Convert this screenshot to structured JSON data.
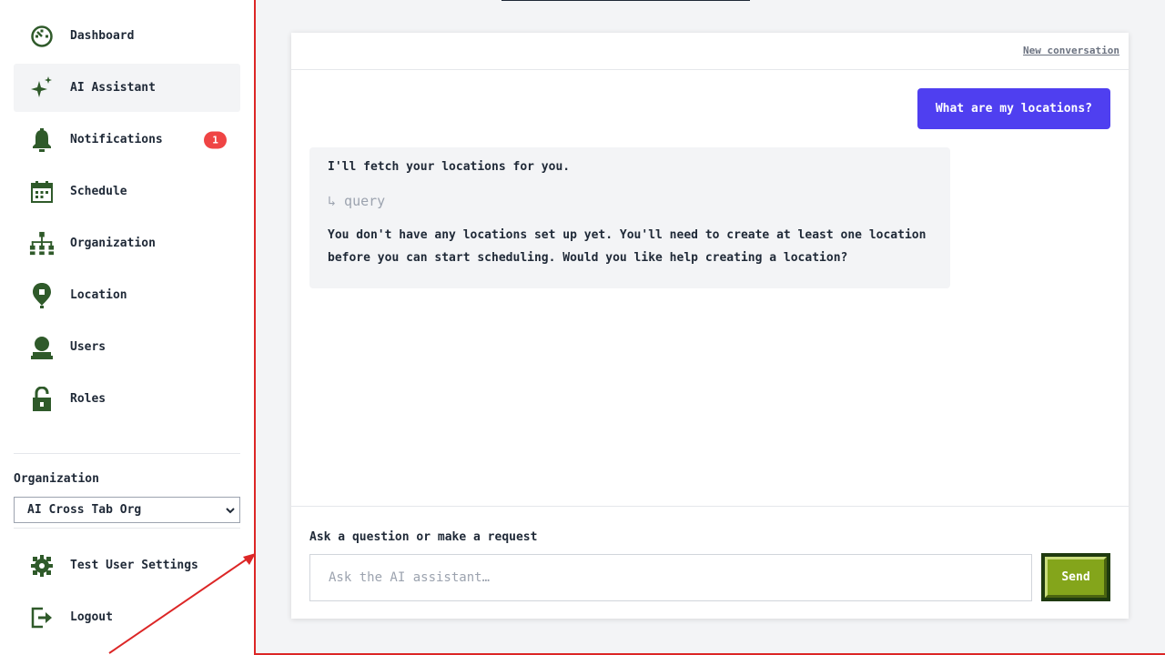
{
  "sidebar": {
    "items": [
      {
        "label": "Dashboard",
        "icon": "dashboard-icon"
      },
      {
        "label": "AI Assistant",
        "icon": "sparkle-icon",
        "active": true
      },
      {
        "label": "Notifications",
        "icon": "bell-icon",
        "badge": "1"
      },
      {
        "label": "Schedule",
        "icon": "calendar-icon"
      },
      {
        "label": "Organization",
        "icon": "org-chart-icon"
      },
      {
        "label": "Location",
        "icon": "location-pin-icon"
      },
      {
        "label": "Users",
        "icon": "user-icon"
      },
      {
        "label": "Roles",
        "icon": "lock-icon"
      }
    ],
    "organization_label": "Organization",
    "organization_value": "AI Cross Tab Org",
    "bottom_items": [
      {
        "label": "Test User Settings",
        "icon": "gear-icon"
      },
      {
        "label": "Logout",
        "icon": "logout-icon"
      }
    ]
  },
  "chat": {
    "new_conversation": "New conversation",
    "user_message": "What are my locations?",
    "assistant": {
      "intro": "I'll fetch your locations for you.",
      "tool_call": "↳ query",
      "response": "You don't have any locations set up yet. You'll need to create at least one location before you can start scheduling. Would you like help creating a location?"
    },
    "composer_label": "Ask a question or make a request",
    "composer_placeholder": "Ask the AI assistant…",
    "send_label": "Send"
  },
  "colors": {
    "icon_green": "#2f5a2a",
    "accent_purple": "#4f3ff0",
    "send_green": "#84a51b",
    "badge_red": "#ef4444",
    "annotation_red": "#dc2626"
  }
}
